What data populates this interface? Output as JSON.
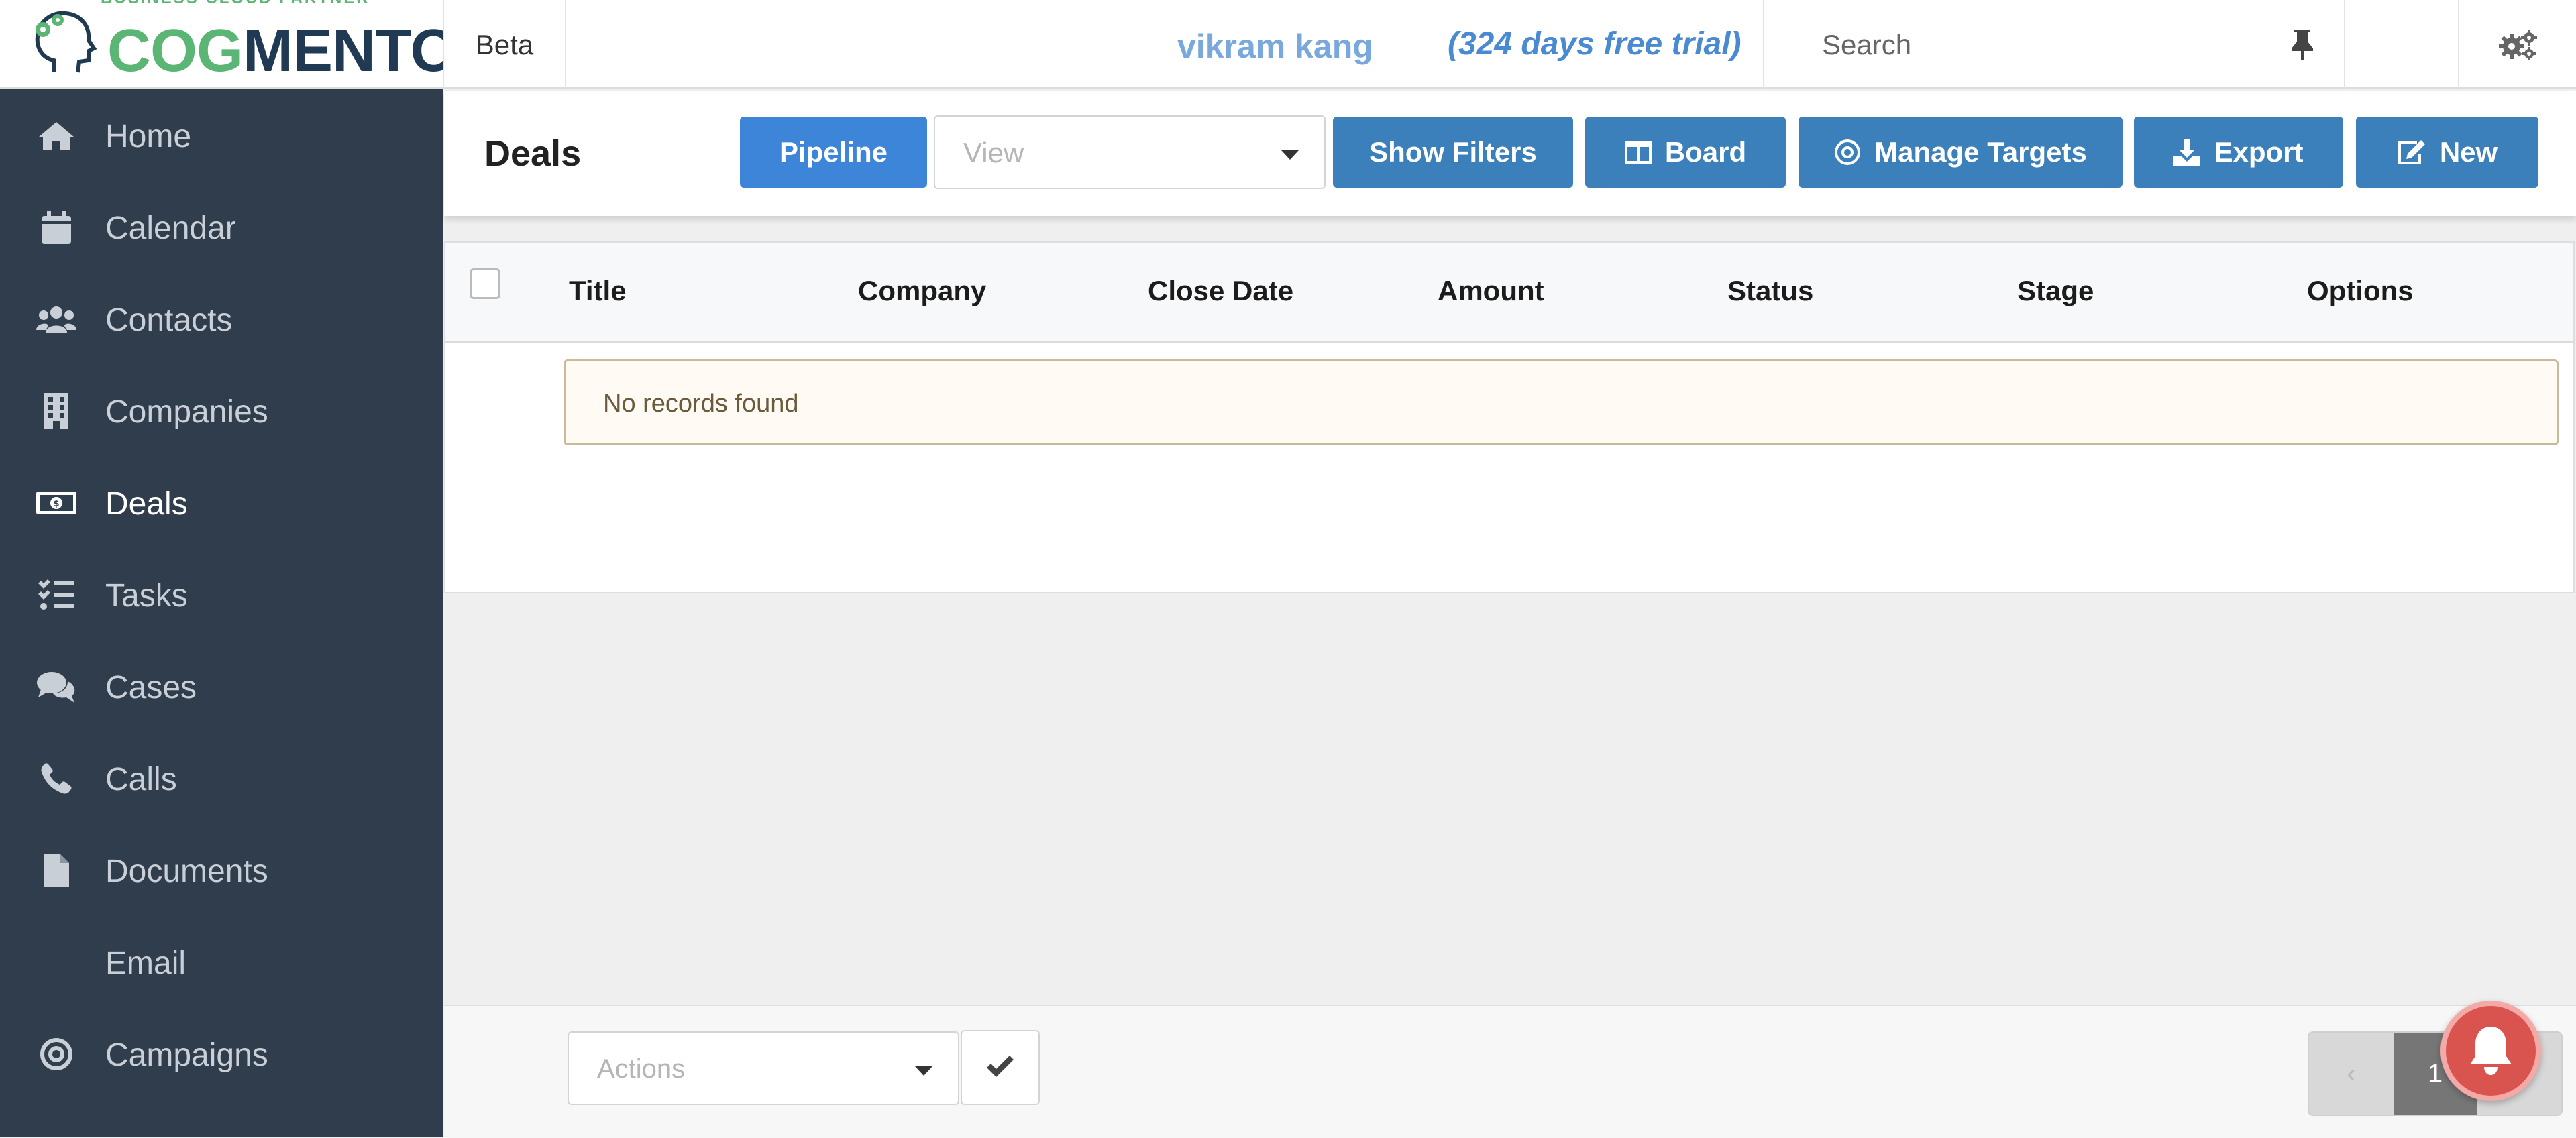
{
  "header": {
    "logo_tagline": "BUSINESS CLOUD PARTNER",
    "logo_part1": "COG",
    "logo_part2": "MENTO",
    "beta_label": "Beta",
    "username": "vikram kang",
    "trial_text": "(324 days free trial)",
    "search_placeholder": "Search"
  },
  "sidebar": {
    "items": [
      {
        "label": "Home",
        "icon": "home-icon"
      },
      {
        "label": "Calendar",
        "icon": "calendar-icon"
      },
      {
        "label": "Contacts",
        "icon": "users-icon"
      },
      {
        "label": "Companies",
        "icon": "building-icon"
      },
      {
        "label": "Deals",
        "icon": "money-icon",
        "active": true
      },
      {
        "label": "Tasks",
        "icon": "tasks-icon"
      },
      {
        "label": "Cases",
        "icon": "comments-icon"
      },
      {
        "label": "Calls",
        "icon": "phone-icon"
      },
      {
        "label": "Documents",
        "icon": "file-icon"
      },
      {
        "label": "Email",
        "icon": ""
      },
      {
        "label": "Campaigns",
        "icon": "bullseye-icon"
      }
    ]
  },
  "deals": {
    "title": "Deals",
    "buttons": {
      "pipeline": "Pipeline",
      "view_placeholder": "View",
      "show_filters": "Show Filters",
      "board": "Board",
      "manage_targets": "Manage Targets",
      "export": "Export",
      "new": "New"
    },
    "columns": [
      "Title",
      "Company",
      "Close Date",
      "Amount",
      "Status",
      "Stage",
      "Options"
    ],
    "empty_message": "No records found"
  },
  "footer": {
    "actions_placeholder": "Actions",
    "current_page": "1"
  },
  "colors": {
    "sidebar_bg": "#2f3d4c",
    "button_blue": "#3b80ba",
    "pipeline_blue": "#3c85d8",
    "notification_red": "#d9534f",
    "logo_green": "#5bb574",
    "logo_navy": "#1f3a52"
  }
}
